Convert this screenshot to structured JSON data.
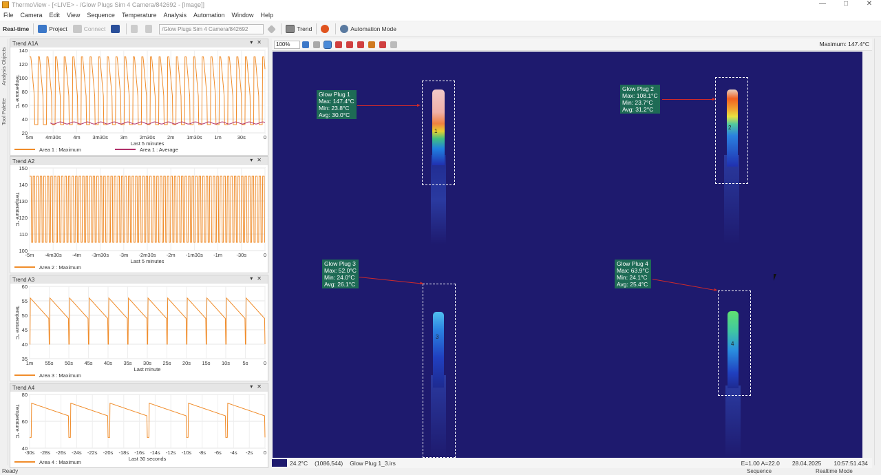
{
  "window": {
    "title": "ThermoView - [<LIVE> - /Glow Plugs Sim 4 Camera/842692 - [Image]]",
    "min": "—",
    "max": "□",
    "close": "✕"
  },
  "menu": [
    "File",
    "Camera",
    "Edit",
    "View",
    "Sequence",
    "Temperature",
    "Analysis",
    "Automation",
    "Window",
    "Help"
  ],
  "toolbar": {
    "realtime": "Real-time",
    "project": "Project",
    "connect": "Connect",
    "path": "/Glow Plugs Sim 4 Camera/842692",
    "trend": "Trend",
    "automation": "Automation Mode"
  },
  "sidetabs": {
    "analysis": "Analysis Objects",
    "toolpalette": "Tool Palette"
  },
  "trends": [
    {
      "title": "Trend A1A",
      "ylabel": "Temperature °C",
      "yticks": [
        "140",
        "120",
        "100",
        "80",
        "60",
        "40",
        "20"
      ],
      "xticks": [
        "5m",
        "4m30s",
        "4m",
        "3m30s",
        "3m",
        "2m30s",
        "2m",
        "1m30s",
        "1m",
        "30s",
        "0"
      ],
      "xlabel": "Last 5 minutes",
      "legend": [
        {
          "name": "Area 1 : Maximum",
          "color": "#f08c2a"
        },
        {
          "name": "Area 1 : Average",
          "color": "#b0306a"
        }
      ]
    },
    {
      "title": "Trend A2",
      "ylabel": "Temperature °C",
      "yticks": [
        "150",
        "140",
        "130",
        "120",
        "110",
        "100"
      ],
      "xticks": [
        "-5m",
        "-4m30s",
        "-4m",
        "-3m30s",
        "-3m",
        "-2m30s",
        "-2m",
        "-1m30s",
        "-1m",
        "-30s",
        "0"
      ],
      "xlabel": "Last 5 minutes",
      "legend": [
        {
          "name": "Area 2 : Maximum",
          "color": "#f08c2a"
        }
      ]
    },
    {
      "title": "Trend A3",
      "ylabel": "Temperature °C",
      "yticks": [
        "60",
        "55",
        "50",
        "45",
        "40",
        "35"
      ],
      "xticks": [
        "1m",
        "55s",
        "50s",
        "45s",
        "40s",
        "35s",
        "30s",
        "25s",
        "20s",
        "15s",
        "10s",
        "5s",
        "0"
      ],
      "xlabel": "Last minute",
      "legend": [
        {
          "name": "Area 3 : Maximum",
          "color": "#f08c2a"
        }
      ]
    },
    {
      "title": "Trend A4",
      "ylabel": "Temperature °C",
      "yticks": [
        "80",
        "60",
        "40"
      ],
      "xticks": [
        "-30s",
        "-28s",
        "-26s",
        "-24s",
        "-22s",
        "-20s",
        "-18s",
        "-16s",
        "-14s",
        "-12s",
        "-10s",
        "-8s",
        "-6s",
        "-4s",
        "-2s",
        "0"
      ],
      "xlabel": "Last 30 seconds",
      "legend": [
        {
          "name": "Area 4 : Maximum",
          "color": "#f08c2a"
        }
      ]
    }
  ],
  "image": {
    "zoom": "100%",
    "maximum": "Maximum: 147.4°C",
    "plugs": [
      {
        "label": "Glow Plug 1",
        "max": "Max: 147.4°C",
        "min": "Min: 23.8°C",
        "avg": "Avg: 30.0°C",
        "marker": "1"
      },
      {
        "label": "Glow Plug 2",
        "max": "Max: 108.1°C",
        "min": "Min: 23.7°C",
        "avg": "Avg: 31.2°C",
        "marker": "2"
      },
      {
        "label": "Glow Plug 3",
        "max": "Max: 52.0°C",
        "min": "Min: 24.0°C",
        "avg": "Avg: 26.1°C",
        "marker": "3"
      },
      {
        "label": "Glow Plug 4",
        "max": "Max: 63.9°C",
        "min": "Min: 24.1°C",
        "avg": "Avg: 25.4°C",
        "marker": "4"
      }
    ]
  },
  "imgstatus": {
    "temp": "24.2°C",
    "coords": "(1086,544)",
    "file": "Glow Plug 1_3.irs",
    "emissivity": "E=1.00 A=22.0",
    "date": "28.04.2025",
    "time": "10:57:51.434"
  },
  "status": {
    "left": "Ready",
    "mid": "Sequence",
    "right": "Realtime Mode"
  }
}
